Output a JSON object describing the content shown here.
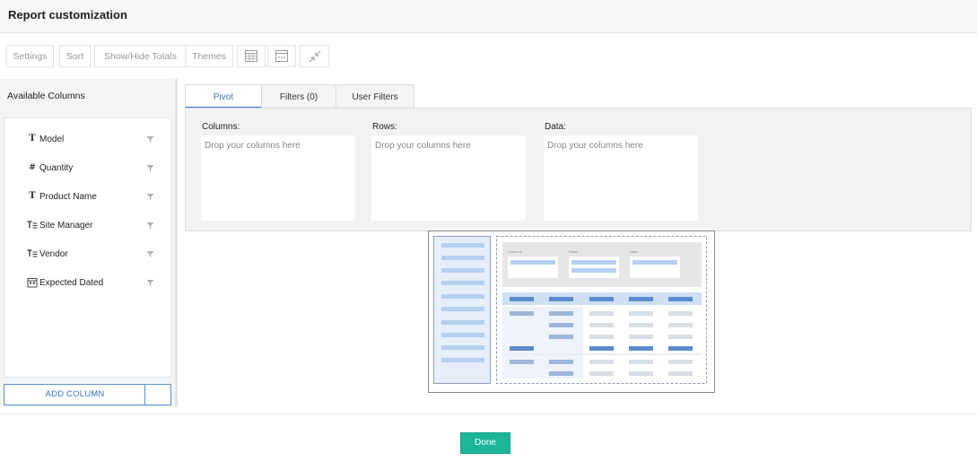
{
  "header": {
    "title": "Report customization"
  },
  "toolbar": {
    "settings": "Settings",
    "sort": "Sort",
    "show_hide_totals": "Show/Hide Totals",
    "themes": "Themes",
    "icons": [
      "table-layout-icon",
      "compact-layout-icon",
      "collapse-icon"
    ]
  },
  "left_panel": {
    "title": "Available Columns",
    "columns": [
      {
        "label": "Model",
        "icon": "text-type-icon"
      },
      {
        "label": "Quantity",
        "icon": "number-type-icon"
      },
      {
        "label": "Product Name",
        "icon": "text-type-icon"
      },
      {
        "label": "Site Manager",
        "icon": "lookup-type-icon"
      },
      {
        "label": "Vendor",
        "icon": "lookup-type-icon"
      },
      {
        "label": "Expected Dated",
        "icon": "date-type-icon"
      }
    ],
    "add_column": "ADD COLUMN"
  },
  "tabs": [
    {
      "label": "Pivot",
      "active": true
    },
    {
      "label": "Filters (0)",
      "active": false
    },
    {
      "label": "User Filters",
      "active": false
    }
  ],
  "zones": {
    "columns": {
      "label": "Columns:",
      "placeholder": "Drop your columns here"
    },
    "rows": {
      "label": "Rows:",
      "placeholder": "Drop your columns here"
    },
    "data": {
      "label": "Data:",
      "placeholder": "Drop your columns here"
    }
  },
  "preview": {
    "labels": [
      "Columns",
      "Rows",
      "Data"
    ]
  },
  "footer": {
    "done": "Done"
  },
  "colors": {
    "accent_blue": "#3a72c4",
    "done_green": "#1cb597"
  }
}
